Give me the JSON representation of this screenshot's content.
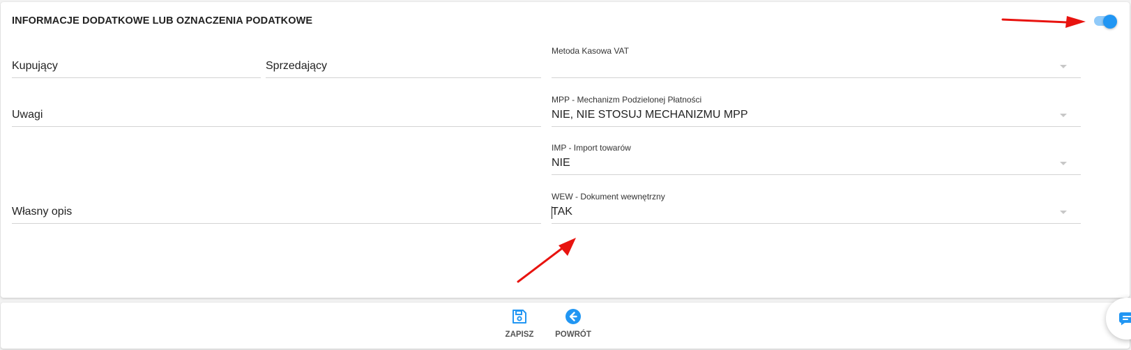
{
  "section": {
    "title": "INFORMACJE DODATKOWE LUB OZNACZENIA PODATKOWE",
    "toggle_on": true
  },
  "fields": {
    "kupujacy": "Kupujący",
    "sprzedajacy": "Sprzedający",
    "uwagi": "Uwagi",
    "wlasny_opis": "Własny opis"
  },
  "selects": {
    "metoda_kasowa": {
      "label": "Metoda Kasowa VAT",
      "value": ""
    },
    "mpp": {
      "label": "MPP - Mechanizm Podzielonej Płatności",
      "value": "NIE, NIE STOSUJ MECHANIZMU MPP"
    },
    "imp": {
      "label": "IMP - Import towarów",
      "value": "NIE"
    },
    "wew": {
      "label": "WEW - Dokument wewnętrzny",
      "value": "TAK"
    }
  },
  "footer": {
    "save_label": "ZAPISZ",
    "back_label": "POWRÓT"
  },
  "icons": {
    "save": "floppy-disk-icon",
    "back": "arrow-left-circle-icon",
    "chat": "chat-bubble-icon"
  },
  "colors": {
    "accent": "#2196f3",
    "toggle_track": "#90caf9",
    "annotation_arrow": "#e8130f"
  }
}
